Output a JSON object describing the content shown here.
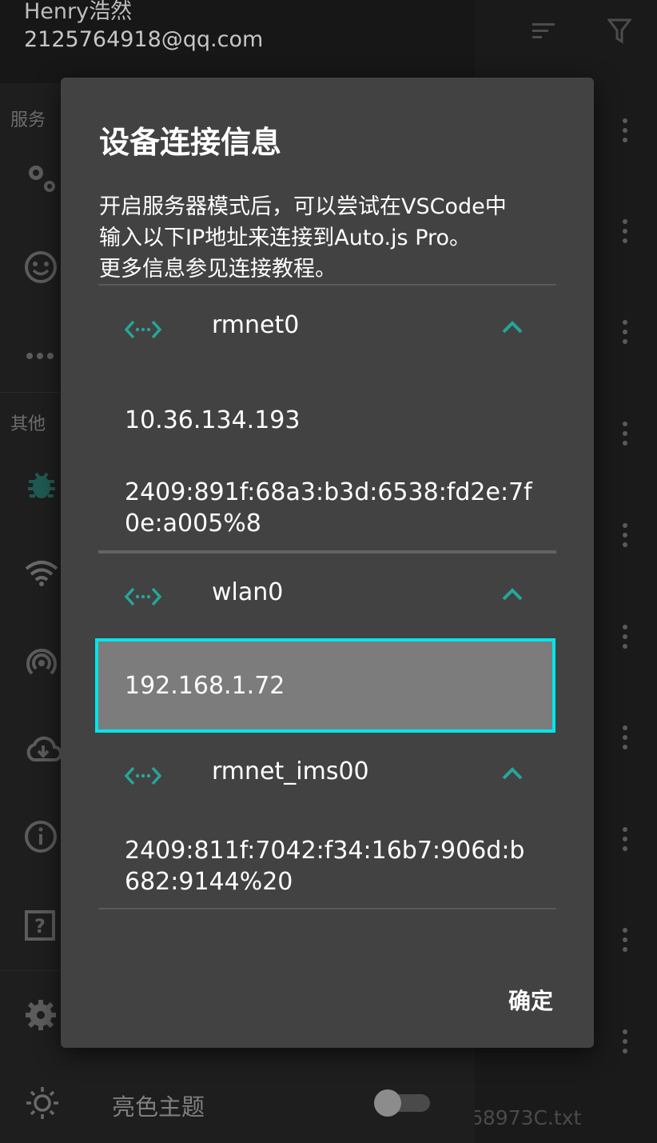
{
  "drawer": {
    "user_name": "Henry浩然",
    "user_email": "2125764918@qq.com",
    "section_services": "服务",
    "section_other": "其他",
    "theme_label": "亮色主题",
    "theme_toggle_on": false
  },
  "background": {
    "file_name_partial": "68973C.txt"
  },
  "dialog": {
    "title": "设备连接信息",
    "message_lines": [
      "开启服务器模式后，可以尝试在VSCode中",
      "输入以下IP地址来连接到Auto.js Pro。",
      "更多信息参见连接教程。"
    ],
    "interfaces": [
      {
        "name": "rmnet0",
        "addresses": [
          "10.36.134.193",
          "2409:891f:68a3:b3d:6538:fd2e:7f",
          "0e:a005%8"
        ]
      },
      {
        "name": "wlan0",
        "addresses": [
          "192.168.1.72"
        ]
      },
      {
        "name": "rmnet_ims00",
        "addresses": [
          "2409:811f:7042:f34:16b7:906d:b",
          "682:9144%20"
        ]
      }
    ],
    "ok_label": "确定"
  },
  "colors": {
    "accent": "#26a69a",
    "selection_border": "#00e5ee",
    "dialog_bg": "#424242"
  }
}
